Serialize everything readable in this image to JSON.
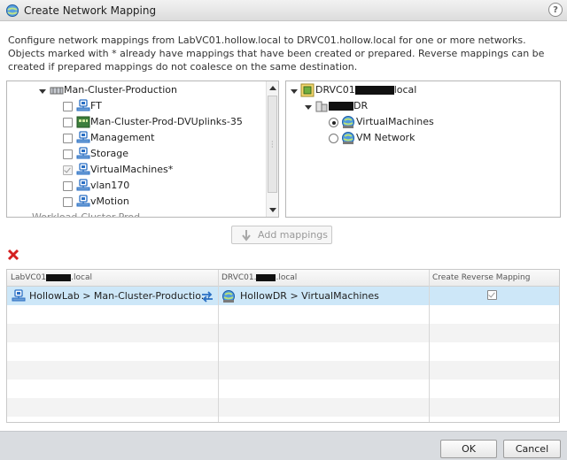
{
  "window": {
    "title": "Create Network Mapping",
    "help_label": "?"
  },
  "description": "Configure network mappings from LabVC01.hollow.local to DRVC01.hollow.local for one or more networks. Objects marked with * already have mappings that have been created or prepared. Reverse mappings can be created if prepared mappings do not coalesce on the same destination.",
  "source_tree": {
    "cluster": "Man-Cluster-Production",
    "items": [
      {
        "label": "FT",
        "checked": false
      },
      {
        "label": "Man-Cluster-Prod-DVUplinks-35",
        "checked": false
      },
      {
        "label": "Management",
        "checked": false
      },
      {
        "label": "Storage",
        "checked": false
      },
      {
        "label": "VirtualMachines*",
        "checked": true
      },
      {
        "label": "vlan170",
        "checked": false
      },
      {
        "label": "vMotion",
        "checked": false
      }
    ],
    "partial_next": "Workload-Cluster-Prod"
  },
  "target_tree": {
    "vcenter_prefix": "DRVC01",
    "vcenter_suffix": "local",
    "datacenter_suffix": "DR",
    "networks": [
      {
        "label": "VirtualMachines",
        "selected": true
      },
      {
        "label": "VM Network",
        "selected": false
      }
    ]
  },
  "add_mappings_label": "Add mappings",
  "grid": {
    "headers": {
      "source_prefix": "LabVC01",
      "source_suffix": ".local",
      "target_prefix": "DRVC01.",
      "target_suffix": ".local",
      "reverse": "Create Reverse Mapping"
    },
    "rows": [
      {
        "source": "HollowLab > Man-Cluster-Productio...",
        "target": "HollowDR > VirtualMachines",
        "reverse_checked": true
      }
    ]
  },
  "footer": {
    "ok_label": "OK",
    "cancel_label": "Cancel"
  },
  "colors": {
    "selected_row": "#cde7f8",
    "delete_red": "#d42020",
    "network_icon_blue": "#2a6fc4"
  }
}
